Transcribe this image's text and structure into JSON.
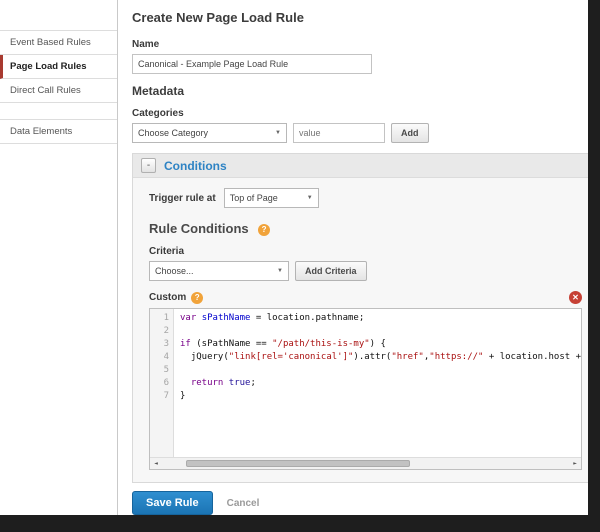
{
  "sidebar": {
    "items": [
      {
        "label": "Event Based Rules",
        "active": false
      },
      {
        "label": "Page Load Rules",
        "active": true
      },
      {
        "label": "Direct Call Rules",
        "active": false
      },
      {
        "label": "Data Elements",
        "active": false
      }
    ]
  },
  "header": {
    "title": "Create New Page Load Rule"
  },
  "form": {
    "name_label": "Name",
    "name_value": "Canonical - Example Page Load Rule",
    "metadata_heading": "Metadata",
    "categories_label": "Categories",
    "category_select_value": "Choose Category",
    "category_value_placeholder": "value",
    "add_button": "Add"
  },
  "conditions": {
    "title": "Conditions",
    "trigger_label": "Trigger rule at",
    "trigger_select_value": "Top of Page",
    "rule_conditions_heading": "Rule Conditions",
    "criteria_label": "Criteria",
    "criteria_select_value": "Choose...",
    "add_criteria_button": "Add Criteria",
    "custom_label": "Custom"
  },
  "editor": {
    "lines": [
      {
        "num": 1,
        "segments": [
          {
            "t": "kw",
            "s": "var"
          },
          {
            "t": "plain",
            "s": " "
          },
          {
            "t": "def",
            "s": "sPathName"
          },
          {
            "t": "plain",
            "s": " = location.pathname;"
          }
        ]
      },
      {
        "num": 2,
        "segments": []
      },
      {
        "num": 3,
        "segments": [
          {
            "t": "kw",
            "s": "if"
          },
          {
            "t": "plain",
            "s": " (sPathName == "
          },
          {
            "t": "str",
            "s": "\"/path/this-is-my\""
          },
          {
            "t": "plain",
            "s": ") {"
          }
        ]
      },
      {
        "num": 4,
        "segments": [
          {
            "t": "plain",
            "s": "  jQuery("
          },
          {
            "t": "str",
            "s": "\"link[rel='canonical']\""
          },
          {
            "t": "plain",
            "s": ").attr("
          },
          {
            "t": "str",
            "s": "\"href\""
          },
          {
            "t": "plain",
            "s": ","
          },
          {
            "t": "str",
            "s": "\"https://\""
          },
          {
            "t": "plain",
            "s": " + location.host +"
          }
        ]
      },
      {
        "num": 5,
        "segments": []
      },
      {
        "num": 6,
        "segments": [
          {
            "t": "plain",
            "s": "  "
          },
          {
            "t": "kw",
            "s": "return"
          },
          {
            "t": "plain",
            "s": " "
          },
          {
            "t": "atom",
            "s": "true"
          },
          {
            "t": "plain",
            "s": ";"
          }
        ]
      },
      {
        "num": 7,
        "segments": [
          {
            "t": "plain",
            "s": "}"
          }
        ]
      }
    ],
    "token_colors": {
      "keyword": "#770088",
      "string": "#aa1111",
      "atom": "#221199",
      "definition": "#0000cc",
      "plain": "#111111"
    }
  },
  "icons": {
    "collapse": "-",
    "help": "?",
    "delete": "✕",
    "caret": "▼",
    "scroll_left": "◄",
    "scroll_right": "►"
  },
  "footer": {
    "save_button": "Save Rule",
    "cancel_link": "Cancel"
  },
  "colors": {
    "conditions_title_blue": "#2e83c4",
    "save_button_blue": "#1b74b4",
    "help_orange": "#f1a33a",
    "delete_red": "#c64135",
    "sidebar_active_accent": "#a83a30",
    "frame_dark": "#1e1e1e"
  }
}
